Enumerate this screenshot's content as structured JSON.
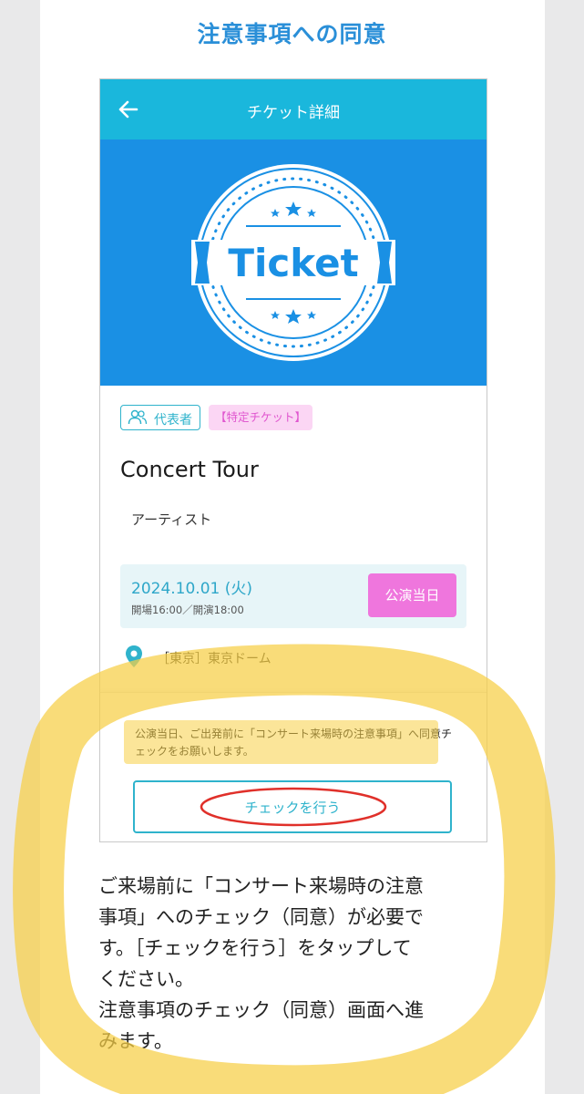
{
  "page": {
    "title": "注意事項への同意"
  },
  "appbar": {
    "back_icon": "arrow-left-icon",
    "title": "チケット詳細"
  },
  "hero": {
    "stamp_text": "Ticket",
    "background": "#1a90e4"
  },
  "tags": {
    "representative": "代表者",
    "special": "【特定チケット】"
  },
  "event": {
    "title": "Concert Tour",
    "artist": "アーティスト"
  },
  "schedule": {
    "date": "2024.10.01 (火)",
    "times": "開場16:00／開演18:00",
    "status_badge": "公演当日"
  },
  "venue": {
    "icon": "map-pin-icon",
    "text": "［東京］東京ドーム"
  },
  "check_panel": {
    "notice": "公演当日、ご出発前に「コンサート来場時の注意事項」へ同意チェックをお願いします。",
    "button_label": "チェックを行う"
  },
  "explanation": {
    "lines": [
      "ご来場前に「コンサート来場時の注意",
      "事項」へのチェック（同意）が必要で",
      "す。［チェックを行う］をタップして",
      "ください。",
      "注意事項のチェック（同意）画面へ進",
      "みます。"
    ]
  },
  "colors": {
    "accent": "#1ab7dc",
    "title_blue": "#2a8fd8",
    "badge_pink": "#ef76dd",
    "highlight_yellow": "#f7cf45",
    "annotation_red": "#e0302a"
  }
}
